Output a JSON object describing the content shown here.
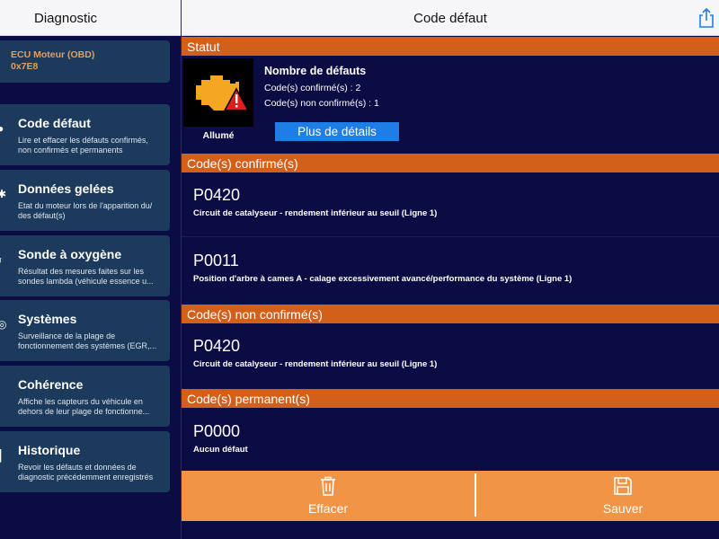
{
  "left_header": {
    "title": "Diagnostic"
  },
  "header": {
    "title": "Code défaut",
    "share_icon": "share-icon"
  },
  "ecu": {
    "name": "ECU Moteur (OBD)",
    "address": "0x7E8"
  },
  "sidebar": {
    "items": [
      {
        "title": "Code défaut",
        "desc1": "Lire et effacer les défauts confirmés,",
        "desc2": "non confirmés et permanents"
      },
      {
        "title": "Données gelées",
        "desc1": "Etat du moteur lors de l'apparition du/",
        "desc2": "des défaut(s)"
      },
      {
        "title": "Sonde à oxygène",
        "desc1": "Résultat des mesures faites sur les",
        "desc2": "sondes lambda (véhicule essence u..."
      },
      {
        "title": "Systèmes",
        "desc1": "Surveillance de la plage de",
        "desc2": "fonctionnement des systèmes (EGR,..."
      },
      {
        "title": "Cohérence",
        "desc1": "Affiche les capteurs du véhicule en",
        "desc2": "dehors de leur plage de fonctionne..."
      },
      {
        "title": "Historique",
        "desc1": "Revoir les défauts et données de",
        "desc2": "diagnostic précédemment enregistrés"
      }
    ]
  },
  "status": {
    "header": "Statut",
    "engine_state": "Allumé",
    "faults_title": "Nombre de défauts",
    "confirmed": "Code(s) confirmé(s) : 2",
    "unconfirmed": "Code(s) non confirmé(s) : 1",
    "details_button": "Plus de détails",
    "indicator_color": "#f5a623",
    "warning_color": "#e02020"
  },
  "confirmed": {
    "header": "Code(s) confirmé(s)",
    "codes": [
      {
        "code": "P0420",
        "desc": "Circuit de catalyseur - rendement inférieur au seuil (Ligne 1)"
      },
      {
        "code": "P0011",
        "desc": "Position d'arbre à cames A - calage excessivement avancé/performance du système (Ligne 1)"
      }
    ]
  },
  "unconfirmed": {
    "header": "Code(s) non confirmé(s)",
    "codes": [
      {
        "code": "P0420",
        "desc": "Circuit de catalyseur - rendement inférieur au seuil (Ligne 1)"
      }
    ]
  },
  "permanent": {
    "header": "Code(s) permanent(s)",
    "codes": [
      {
        "code": "P0000",
        "desc": "Aucun défaut"
      }
    ]
  },
  "toolbar": {
    "clear_label": "Effacer",
    "save_label": "Sauver",
    "clear_icon": "trash-icon",
    "save_icon": "floppy-disk-icon"
  },
  "colors": {
    "accent_orange": "#d2601b",
    "toolbar_orange": "#f29445",
    "background": "#0c0c45",
    "card": "#1b3a5c",
    "button_blue": "#1e7de6"
  }
}
